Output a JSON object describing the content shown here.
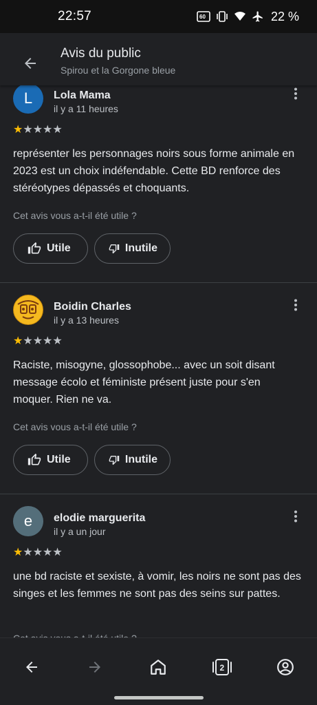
{
  "status": {
    "time": "22:57",
    "battery": "22 %"
  },
  "header": {
    "title": "Avis du public",
    "subtitle": "Spirou et la Gorgone bleue"
  },
  "helpful_question": "Cet avis vous a-t-il été utile ?",
  "buttons": {
    "useful": "Utile",
    "not_useful": "Inutile"
  },
  "reviews": [
    {
      "avatar_letter": "L",
      "avatar_color": "#1a6bb5",
      "name": "Lola Mama",
      "time": "il y a 11 heures",
      "rating": 1,
      "max_rating": 5,
      "text": "représenter les personnages noirs sous forme animale en 2023 est un choix indéfendable. Cette BD renforce des stéréotypes dépassés et choquants."
    },
    {
      "avatar_letter": "",
      "avatar_color": "#f5b91f",
      "name": "Boidin Charles",
      "time": "il y a 13 heures",
      "rating": 1,
      "max_rating": 5,
      "text": "Raciste, misogyne, glossophobe... avec un soit disant message écolo et féministe présent juste pour s'en moquer. Rien ne va."
    },
    {
      "avatar_letter": "e",
      "avatar_color": "#546e7a",
      "name": "elodie marguerita",
      "time": "il y a un jour",
      "rating": 1,
      "max_rating": 5,
      "text": "une bd raciste et sexiste, à vomir, les noirs ne sont pas des singes et les femmes ne sont pas des seins sur pattes."
    }
  ],
  "tabs_count": "2",
  "colors": {
    "star_filled": "#fbbc04",
    "star_empty": "#bdc1c6",
    "background": "#202124"
  }
}
